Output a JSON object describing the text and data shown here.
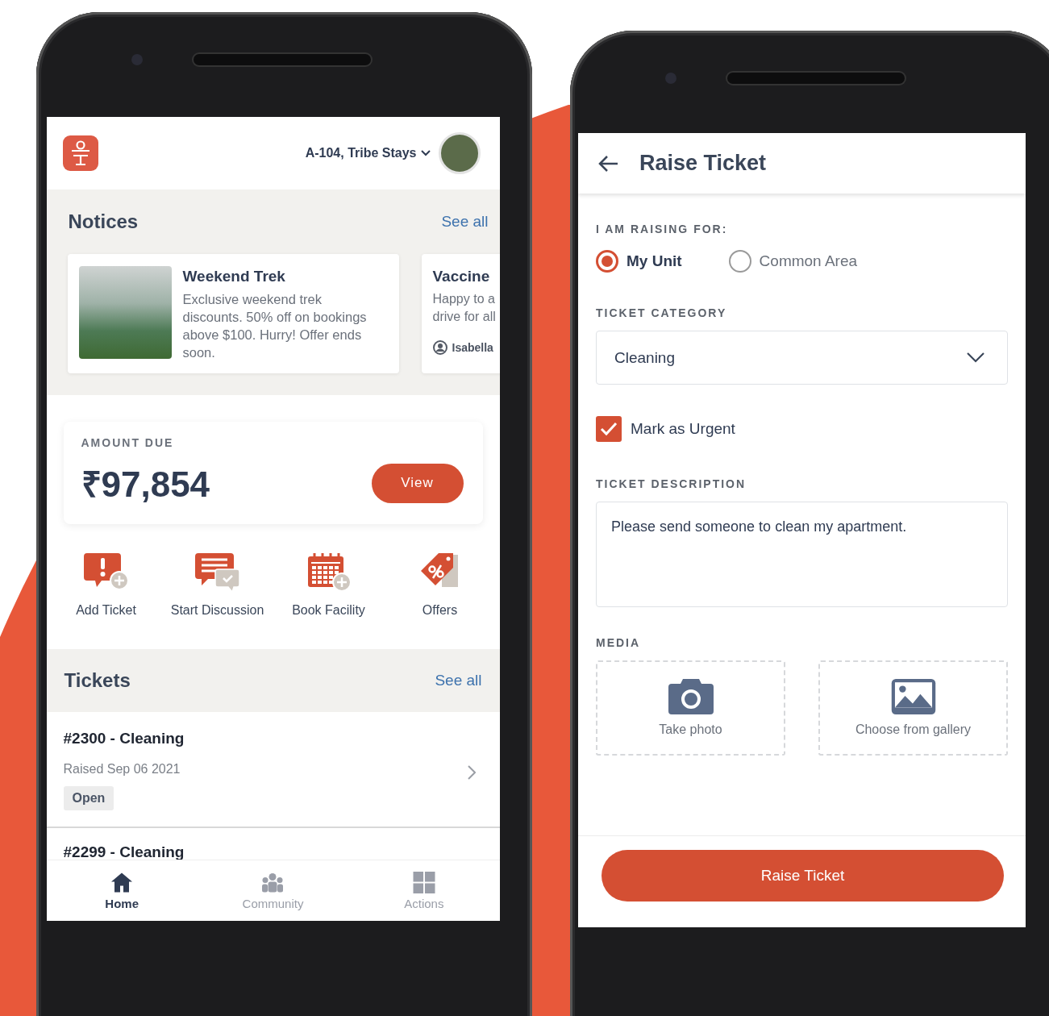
{
  "home_screen": {
    "header": {
      "location": "A-104, Tribe Stays"
    },
    "notices": {
      "title": "Notices",
      "see_all": "See all",
      "items": [
        {
          "title": "Weekend Trek",
          "body": "Exclusive weekend trek discounts. 50% off on bookings above $100. Hurry! Offer ends soon."
        },
        {
          "title": "Vaccine",
          "body_lines": [
            "Happy to a",
            "drive for all"
          ],
          "author": "Isabella"
        }
      ]
    },
    "amount_due": {
      "label": "AMOUNT DUE",
      "amount": "₹97,854",
      "button": "View"
    },
    "quick_actions": [
      {
        "label": "Add Ticket",
        "kind": "ticket"
      },
      {
        "label": "Start Discussion",
        "kind": "discussion"
      },
      {
        "label": "Book Facility",
        "kind": "facility"
      },
      {
        "label": "Offers",
        "kind": "offer"
      }
    ],
    "tickets": {
      "title": "Tickets",
      "see_all": "See all",
      "items": [
        {
          "title": "#2300 - Cleaning",
          "raised": "Raised Sep 06 2021",
          "status": "Open"
        },
        {
          "title": "#2299 - Cleaning"
        }
      ]
    },
    "bottom_nav": [
      {
        "label": "Home",
        "kind": "home",
        "selected": true
      },
      {
        "label": "Community",
        "kind": "community",
        "selected": false
      },
      {
        "label": "Actions",
        "kind": "actions",
        "selected": false
      }
    ]
  },
  "raise_ticket_screen": {
    "title": "Raise Ticket",
    "raising_for": {
      "label": "I AM RAISING FOR:",
      "options": [
        {
          "label": "My Unit",
          "selected": true
        },
        {
          "label": "Common Area",
          "selected": false
        }
      ]
    },
    "category": {
      "label": "TICKET CATEGORY",
      "value": "Cleaning"
    },
    "urgent": {
      "label": "Mark as Urgent",
      "checked": true
    },
    "description": {
      "label": "TICKET DESCRIPTION",
      "value": "Please send someone to clean my apartment."
    },
    "media": {
      "label": "MEDIA",
      "options": [
        {
          "label": "Take photo",
          "kind": "camera"
        },
        {
          "label": "Choose from gallery",
          "kind": "gallery"
        }
      ]
    },
    "submit": "Raise Ticket"
  }
}
